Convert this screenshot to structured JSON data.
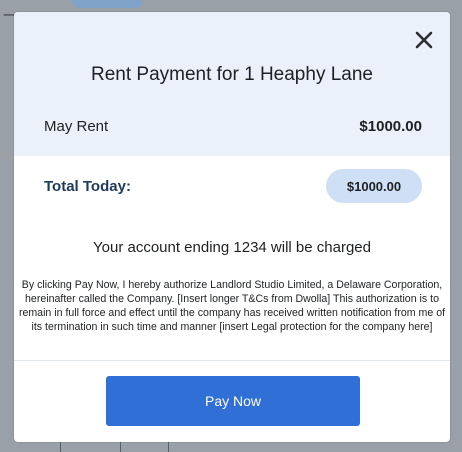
{
  "modal": {
    "title": "Rent Payment for 1 Heaphy Lane",
    "line_item": {
      "label": "May Rent",
      "amount": "$1000.00"
    },
    "total": {
      "label": "Total Today:",
      "amount": "$1000.00"
    },
    "charge_note": "Your account ending 1234 will be charged",
    "legal_text": "By clicking Pay Now, I hereby authorize Landlord Studio Limited, a Delaware Corporation, hereinafter called the Company. [Insert longer T&Cs from Dwolla] This authorization is to remain in full force and effect until the company has received written notification from me of its termination in such time and manner [insert Legal protection for the company here]",
    "pay_button_label": "Pay Now",
    "close_icon": "close-icon"
  },
  "colors": {
    "header_bg": "#eaf1fb",
    "accent": "#2f6fd6",
    "total_pill": "#cfe0f6",
    "total_label": "#1f3a5c"
  }
}
